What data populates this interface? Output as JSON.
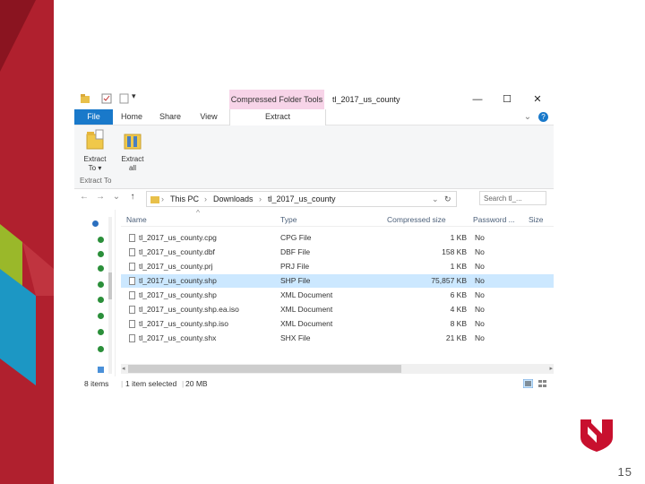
{
  "window": {
    "title": "tl_2017_us_county",
    "minimize": "—",
    "maximize": "☐",
    "close": "✕",
    "context_tab": "Compressed Folder Tools"
  },
  "menu": {
    "file": "File",
    "home": "Home",
    "share": "Share",
    "view": "View",
    "extract": "Extract",
    "help": "?"
  },
  "ribbon": {
    "extract_to": "Extract\nTo ▾",
    "extract_all": "Extract\nall",
    "group_label": "Extract To"
  },
  "address": {
    "back": "←",
    "forward": "→",
    "recent": "⌄",
    "up": "↑",
    "crumbs": [
      "This PC",
      "Downloads",
      "tl_2017_us_county"
    ],
    "separator": "›",
    "refresh": "↻",
    "search_placeholder": "Search tl_..."
  },
  "columns": {
    "name": "Name",
    "type": "Type",
    "compressed_size": "Compressed size",
    "password": "Password ...",
    "size": "Size"
  },
  "files": [
    {
      "name": "tl_2017_us_county.cpg",
      "type": "CPG File",
      "size": "1 KB",
      "password": "No"
    },
    {
      "name": "tl_2017_us_county.dbf",
      "type": "DBF File",
      "size": "158 KB",
      "password": "No"
    },
    {
      "name": "tl_2017_us_county.prj",
      "type": "PRJ File",
      "size": "1 KB",
      "password": "No"
    },
    {
      "name": "tl_2017_us_county.shp",
      "type": "SHP File",
      "size": "75,857 KB",
      "password": "No",
      "selected": true
    },
    {
      "name": "tl_2017_us_county.shp",
      "type": "XML Document",
      "size": "6 KB",
      "password": "No"
    },
    {
      "name": "tl_2017_us_county.shp.ea.iso",
      "type": "XML Document",
      "size": "4 KB",
      "password": "No"
    },
    {
      "name": "tl_2017_us_county.shp.iso",
      "type": "XML Document",
      "size": "8 KB",
      "password": "No"
    },
    {
      "name": "tl_2017_us_county.shx",
      "type": "SHX File",
      "size": "21 KB",
      "password": "No"
    }
  ],
  "status": {
    "items": "8 items",
    "selected": "1 item selected",
    "sel_size": "20 MB"
  },
  "page": {
    "number": "15"
  },
  "colors": {
    "file_tab": "#1979ca",
    "context_tab": "#f7d4e8",
    "selection": "#cce8ff",
    "deco_red": "#b0202e",
    "deco_green": "#9ab82a",
    "deco_blue": "#1c97c4"
  }
}
